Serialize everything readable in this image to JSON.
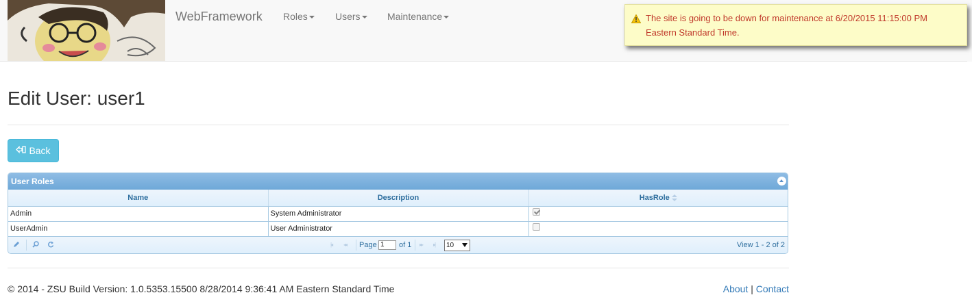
{
  "navbar": {
    "brand": "WebFramework",
    "menu": [
      {
        "label": "Roles"
      },
      {
        "label": "Users"
      },
      {
        "label": "Maintenance"
      }
    ]
  },
  "alert": {
    "message": "The site is going to be down for maintenance at 6/20/2015 11:15:00 PM Eastern Standard Time.",
    "icon": "warning-icon",
    "color": "#c0392b"
  },
  "page": {
    "title": "Edit User: user1",
    "back_label": "Back"
  },
  "grid": {
    "caption": "User Roles",
    "columns": [
      "Name",
      "Description",
      "HasRole"
    ],
    "rows": [
      {
        "name": "Admin",
        "description": "System Administrator",
        "has_role": true
      },
      {
        "name": "UserAdmin",
        "description": "User Administrator",
        "has_role": false
      }
    ],
    "pager": {
      "page_label": "Page",
      "page_value": "1",
      "of_label": "of 1",
      "rows_per_page": "10",
      "view_info": "View 1 - 2 of 2"
    }
  },
  "footer": {
    "text": "© 2014 - ZSU Build Version: 1.0.5353.15500 8/28/2014 9:36:41 AM Eastern Standard Time",
    "about": "About",
    "separator": "|",
    "contact": "Contact"
  },
  "colors": {
    "accent": "#5bc0de",
    "grid_header": "#2e6e9e",
    "link": "#337ab7"
  }
}
